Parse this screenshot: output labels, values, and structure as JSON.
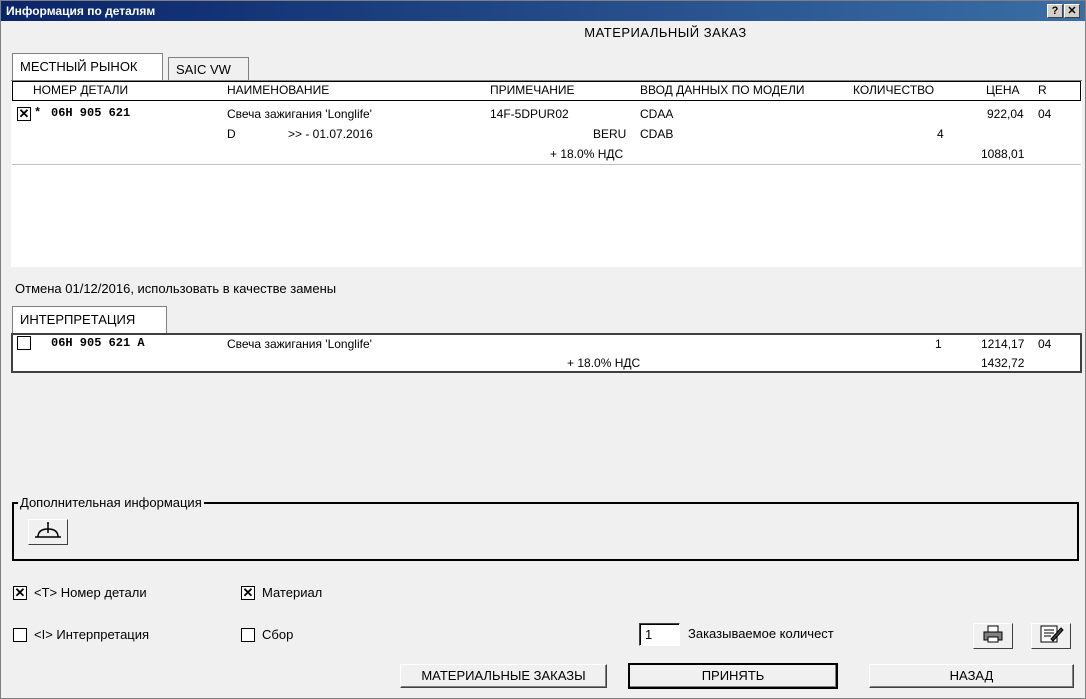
{
  "window": {
    "title": "Информация по деталям",
    "help_label": "?",
    "close_label": "✕"
  },
  "header": {
    "title": "МАТЕРИАЛЬНЫЙ ЗАКАЗ"
  },
  "tabs": [
    {
      "label": "МЕСТНЫЙ РЫНОК",
      "active": true
    },
    {
      "label": "SAIC VW",
      "active": false
    }
  ],
  "columns": {
    "part_number": "НОМЕР ДЕТАЛИ",
    "name": "НАИМЕНОВАНИЕ",
    "note": "ПРИМЕЧАНИЕ",
    "model_input": "ВВОД ДАННЫХ ПО МОДЕЛИ",
    "quantity": "КОЛИЧЕСТВО",
    "price": "ЦЕНА",
    "r": "R"
  },
  "part_row": {
    "checked": true,
    "star": "*",
    "part_number": "06H 905 621",
    "name": "Свеча зажигания 'Longlife'",
    "note": "14F-5DPUR02",
    "model1": "CDAA",
    "price": "922,04",
    "r": "04",
    "line2_code": "D",
    "line2_validity": ">> - 01.07.2016",
    "line2_brand": "BERU",
    "model2": "CDAB",
    "quantity": "4",
    "vat_label": "+ 18.0% НДС",
    "price_with_vat": "1088,01"
  },
  "cancel_notice": "Отмена 01/12/2016, использовать в качестве замены",
  "interp_tab": {
    "label": "ИНТЕРПРЕТАЦИЯ"
  },
  "interp_row": {
    "checked": false,
    "part_number": "06H 905 621 A",
    "name": "Свеча зажигания 'Longlife'",
    "quantity": "1",
    "price": "1214,17",
    "r": "04",
    "vat_label": "+ 18.0% НДС",
    "price_with_vat": "1432,72"
  },
  "additional_info": {
    "label": "Дополнительная информация",
    "icon": "info-signal-icon"
  },
  "options": {
    "part_number_label": "<T> Номер детали",
    "part_number_checked": true,
    "material_label": "Материал",
    "material_checked": true,
    "interpretation_label": "<I> Интерпретация",
    "interpretation_checked": false,
    "assembly_label": "Сбор",
    "assembly_checked": false
  },
  "order_qty": {
    "value": "1",
    "label": "Заказываемое количест"
  },
  "buttons": {
    "material_orders": "МАТЕРИАЛЬНЫЕ ЗАКАЗЫ",
    "accept": "ПРИНЯТЬ",
    "back": "НАЗАД"
  },
  "icons": {
    "print": "printer-icon",
    "edit": "notepad-pencil-icon"
  }
}
